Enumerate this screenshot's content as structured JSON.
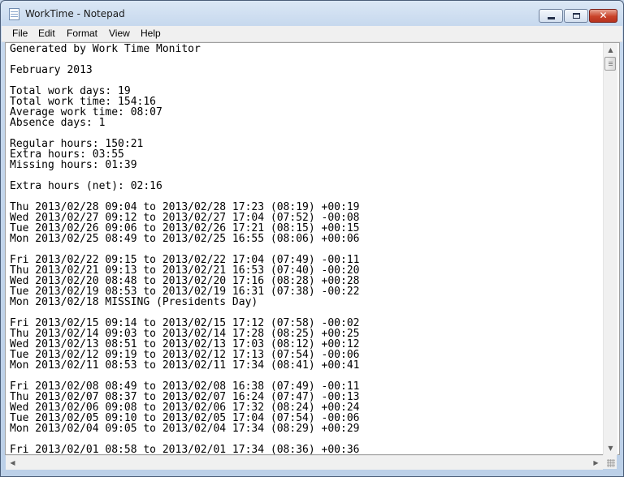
{
  "window": {
    "title": "WorkTime - Notepad"
  },
  "menu": [
    "File",
    "Edit",
    "Format",
    "View",
    "Help"
  ],
  "icons": {
    "app": "notepad-icon",
    "minimize": "minimize-icon",
    "maximize": "maximize-icon",
    "close": "close-icon"
  },
  "document": {
    "lines": [
      "Generated by Work Time Monitor",
      "",
      "February 2013",
      "",
      "Total work days: 19",
      "Total work time: 154:16",
      "Average work time: 08:07",
      "Absence days: 1",
      "",
      "Regular hours: 150:21",
      "Extra hours: 03:55",
      "Missing hours: 01:39",
      "",
      "Extra hours (net): 02:16",
      "",
      "Thu 2013/02/28 09:04 to 2013/02/28 17:23 (08:19) +00:19",
      "Wed 2013/02/27 09:12 to 2013/02/27 17:04 (07:52) -00:08",
      "Tue 2013/02/26 09:06 to 2013/02/26 17:21 (08:15) +00:15",
      "Mon 2013/02/25 08:49 to 2013/02/25 16:55 (08:06) +00:06",
      "",
      "Fri 2013/02/22 09:15 to 2013/02/22 17:04 (07:49) -00:11",
      "Thu 2013/02/21 09:13 to 2013/02/21 16:53 (07:40) -00:20",
      "Wed 2013/02/20 08:48 to 2013/02/20 17:16 (08:28) +00:28",
      "Tue 2013/02/19 08:53 to 2013/02/19 16:31 (07:38) -00:22",
      "Mon 2013/02/18 MISSING (Presidents Day)",
      "",
      "Fri 2013/02/15 09:14 to 2013/02/15 17:12 (07:58) -00:02",
      "Thu 2013/02/14 09:03 to 2013/02/14 17:28 (08:25) +00:25",
      "Wed 2013/02/13 08:51 to 2013/02/13 17:03 (08:12) +00:12",
      "Tue 2013/02/12 09:19 to 2013/02/12 17:13 (07:54) -00:06",
      "Mon 2013/02/11 08:53 to 2013/02/11 17:34 (08:41) +00:41",
      "",
      "Fri 2013/02/08 08:49 to 2013/02/08 16:38 (07:49) -00:11",
      "Thu 2013/02/07 08:37 to 2013/02/07 16:24 (07:47) -00:13",
      "Wed 2013/02/06 09:08 to 2013/02/06 17:32 (08:24) +00:24",
      "Tue 2013/02/05 09:10 to 2013/02/05 17:04 (07:54) -00:06",
      "Mon 2013/02/04 09:05 to 2013/02/04 17:34 (08:29) +00:29",
      "",
      "Fri 2013/02/01 08:58 to 2013/02/01 17:34 (08:36) +00:36"
    ]
  }
}
